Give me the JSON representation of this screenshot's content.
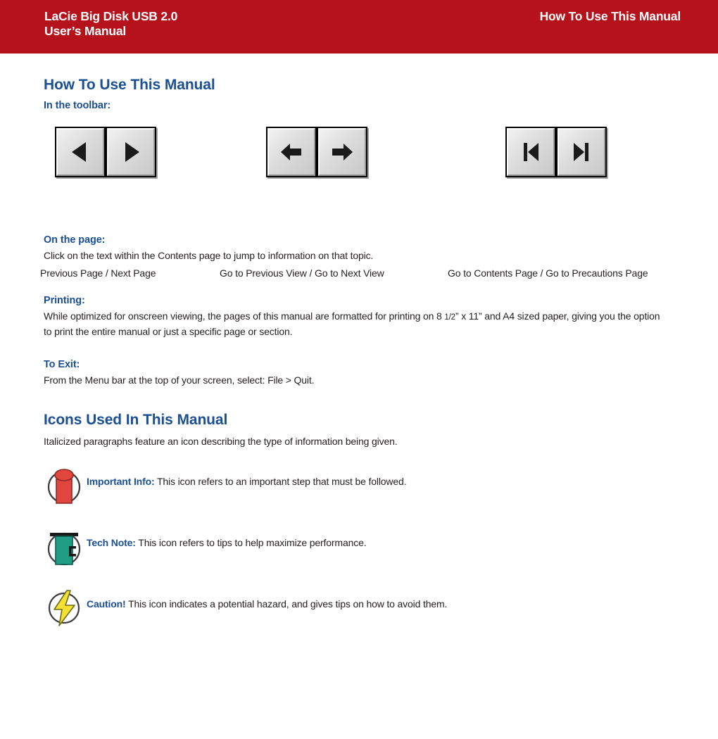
{
  "banner": {
    "product_line1": "LaCie Big Disk USB 2.0",
    "product_line2": "User’s Manual",
    "section_title": "How To Use This Manual",
    "background_color": "#b5121b",
    "text_color": "#ffffff"
  },
  "colors": {
    "heading_blue": "#1b4f93",
    "body_black": "#231f20",
    "banner_red": "#b5121b",
    "icon_red": "#e0453e",
    "icon_green": "#1f9e85",
    "icon_yellow": "#f5e033"
  },
  "main": {
    "title": "How To Use This Manual",
    "toolbar_subheading": "In the toolbar:",
    "toolbar_groups": [
      {
        "caption": "Previous Page / Next Page",
        "buttons": [
          {
            "icon": "triangle-left-icon",
            "label": "Previous Page"
          },
          {
            "icon": "triangle-right-icon",
            "label": "Next Page"
          }
        ]
      },
      {
        "caption": "Go to Previous View / Go to Next View",
        "buttons": [
          {
            "icon": "arrow-left-icon",
            "label": "Go to Previous View"
          },
          {
            "icon": "arrow-right-icon",
            "label": "Go to Next View"
          }
        ]
      },
      {
        "caption": "Go to Contents Page / Go to Precautions Page",
        "buttons": [
          {
            "icon": "skip-to-start-icon",
            "label": "Go to Contents Page"
          },
          {
            "icon": "skip-to-end-icon",
            "label": "Go to Precautions Page"
          }
        ]
      }
    ],
    "sections": [
      {
        "heading": "On the page:",
        "body": "Click on the text within the Contents page to jump to information on that topic."
      },
      {
        "heading": "Printing:",
        "body_part1": "While optimized for onscreen viewing, the pages of this manual are formatted for printing on 8 ",
        "body_fraction": "1/2",
        "body_part2": "” x 11” and A4 sized paper, giving you the option to print the entire manual or just a specific page or section."
      },
      {
        "heading": "To Exit:",
        "body": "From the Menu bar at the top of your screen, select: File > Quit."
      }
    ],
    "icons_title": "Icons Used In This Manual",
    "icons_intro": "Italicized paragraphs feature an icon describing the type of information being given.",
    "icon_items": [
      {
        "icon": "important-info-icon",
        "lead": "Important Info:",
        "text": " This icon refers to an important step that must be followed."
      },
      {
        "icon": "tech-note-icon",
        "lead": "Tech Note:",
        "text": " This icon refers to tips to help maximize performance."
      },
      {
        "icon": "caution-icon",
        "lead": "Caution!",
        "text": " This icon indicates a potential hazard, and gives tips on how to avoid them."
      }
    ]
  }
}
